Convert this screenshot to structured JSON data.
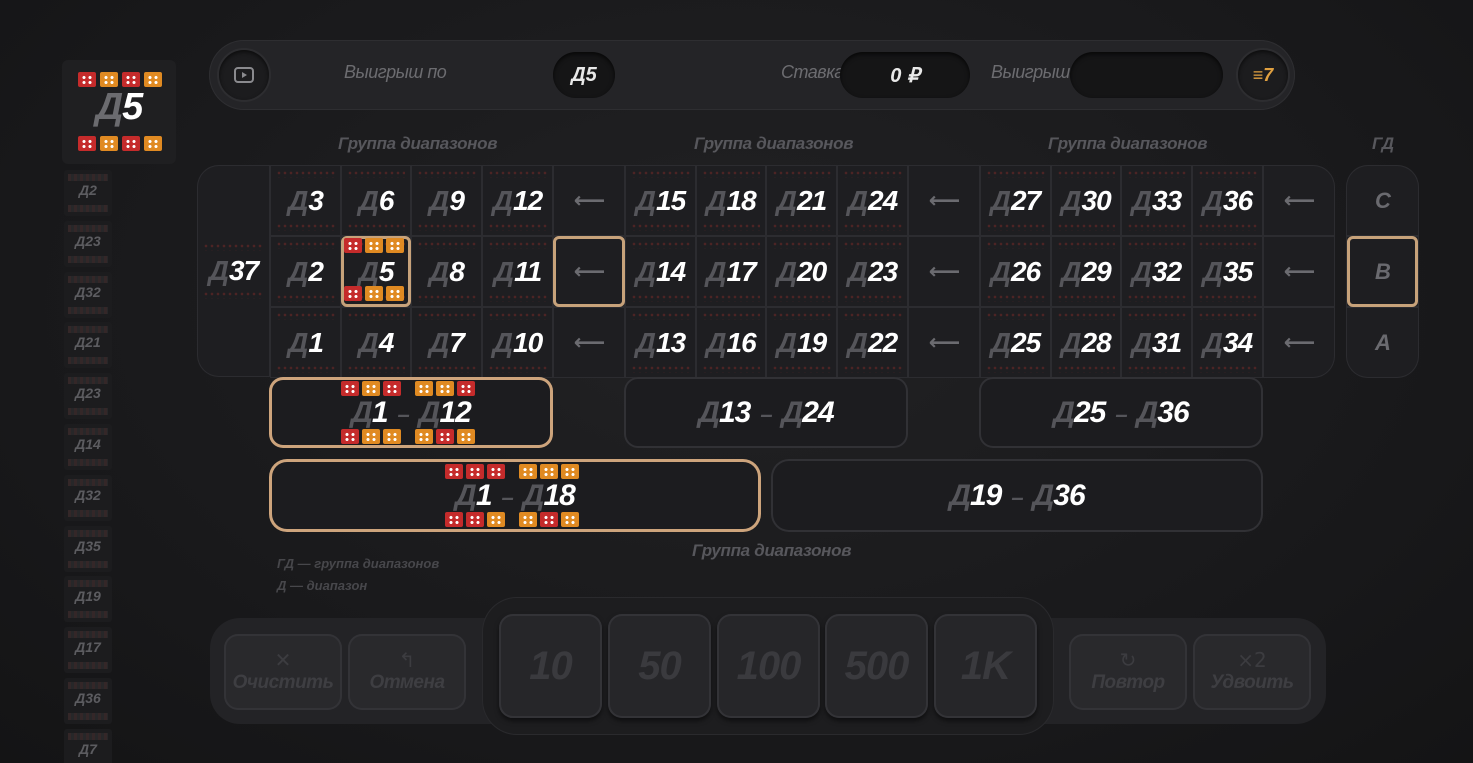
{
  "history": {
    "current": "5",
    "prefix": "Д",
    "items": [
      "2",
      "23",
      "32",
      "21",
      "23",
      "14",
      "32",
      "35",
      "19",
      "17",
      "36",
      "7"
    ]
  },
  "topbar": {
    "win_on_label": "Выигрыш по",
    "win_on_value": "Д5",
    "bet_label": "Ставка",
    "bet_value": "0 ₽",
    "win_label": "Выигрыш",
    "win_value": "",
    "multiplier_badge": "≡7"
  },
  "group_titles": [
    "Группа диапазонов",
    "Группа диапазонов",
    "Группа диапазонов"
  ],
  "gd_title": "ГД",
  "zero": "37",
  "rows": {
    "top": [
      "3",
      "6",
      "9",
      "12",
      "15",
      "18",
      "21",
      "24",
      "27",
      "30",
      "33",
      "36"
    ],
    "mid": [
      "2",
      "5",
      "8",
      "11",
      "14",
      "17",
      "20",
      "23",
      "26",
      "29",
      "32",
      "35"
    ],
    "bot": [
      "1",
      "4",
      "7",
      "10",
      "13",
      "16",
      "19",
      "22",
      "25",
      "28",
      "31",
      "34"
    ]
  },
  "arrow_glyph": "⟵",
  "gd_buttons": [
    "C",
    "B",
    "A"
  ],
  "dozens": [
    {
      "a": "1",
      "b": "12"
    },
    {
      "a": "13",
      "b": "24"
    },
    {
      "a": "25",
      "b": "36"
    }
  ],
  "halves": [
    {
      "a": "1",
      "b": "18"
    },
    {
      "a": "19",
      "b": "36"
    }
  ],
  "range_sep": "–",
  "bottom_group_title": "Группа диапазонов",
  "legend": [
    "ГД — группа диапазонов",
    "Д — диапазон"
  ],
  "controls": {
    "clear": {
      "icon": "✕",
      "label": "Очистить"
    },
    "undo": {
      "icon": "↰",
      "label": "Отмена"
    },
    "repeat": {
      "icon": "↻",
      "label": "Повтор"
    },
    "double": {
      "icon": "×2",
      "label": "Удвоить"
    }
  },
  "chips": [
    "10",
    "50",
    "100",
    "500",
    "1K"
  ],
  "colors": {
    "selected_frame": "#c7a27a",
    "red_die": "#c52b2b",
    "orange_die": "#e08a22"
  }
}
